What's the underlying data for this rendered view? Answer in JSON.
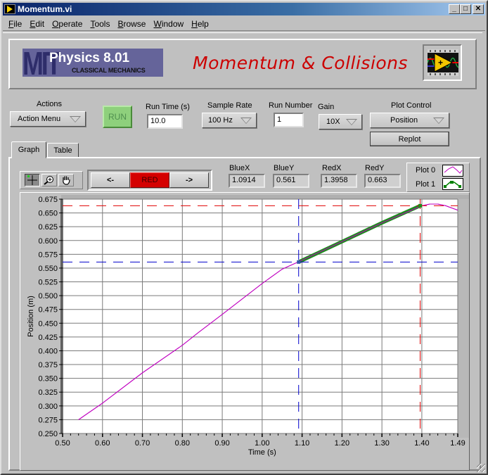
{
  "window": {
    "title": "Momentum.vi",
    "controls": {
      "minimize": "_",
      "maximize": "□",
      "close": "✕"
    }
  },
  "menu": [
    {
      "label": "File",
      "hotkey": "F"
    },
    {
      "label": "Edit",
      "hotkey": "E"
    },
    {
      "label": "Operate",
      "hotkey": "O"
    },
    {
      "label": "Tools",
      "hotkey": "T"
    },
    {
      "label": "Browse",
      "hotkey": "B"
    },
    {
      "label": "Window",
      "hotkey": "W"
    },
    {
      "label": "Help",
      "hotkey": "H"
    }
  ],
  "header": {
    "logo_mit": "MIT",
    "logo_course": "Physics 8.01",
    "logo_subtitle": "CLASSICAL MECHANICS",
    "title": "Momentum & Collisions",
    "vi_icon": "labview-vi-icon"
  },
  "controls": {
    "actions_label": "Actions",
    "actions_value": "Action Menu",
    "run_label": "RUN",
    "run_time_label": "Run Time (s)",
    "run_time_value": "10.0",
    "sample_rate_label": "Sample Rate",
    "sample_rate_value": "100 Hz",
    "run_number_label": "Run Number",
    "run_number_value": "1",
    "gain_label": "Gain",
    "gain_value": "10X",
    "plot_control_label": "Plot Control",
    "plot_control_value": "Position",
    "replot_label": "Replot"
  },
  "tabs": [
    {
      "label": "Graph",
      "active": true
    },
    {
      "label": "Table",
      "active": false
    }
  ],
  "graph_toolbar": {
    "tools": [
      "cursor-crosshair-icon",
      "zoom-icon",
      "pan-hand-icon"
    ],
    "prev_label": "<-",
    "cursor_select_label": "RED",
    "next_label": "->",
    "readouts": [
      {
        "label": "BlueX",
        "value": "1.0914"
      },
      {
        "label": "BlueY",
        "value": "0.561"
      },
      {
        "label": "RedX",
        "value": "1.3958"
      },
      {
        "label": "RedY",
        "value": "0.663"
      }
    ],
    "legend": [
      {
        "label": "Plot 0",
        "color": "#c000c0"
      },
      {
        "label": "Plot 1",
        "color": "#008000"
      }
    ]
  },
  "colors": {
    "plot0": "#c000c0",
    "plot1": "#1e8c1e",
    "blue_cursor": "#0000cc",
    "red_cursor": "#e00000",
    "grid": "#7a7a7a",
    "title_red": "#cc0000",
    "run_green": "#8ed07c"
  },
  "chart_data": {
    "type": "line",
    "title": "",
    "xlabel": "Time (s)",
    "ylabel": "Position (m)",
    "xlim": [
      0.5,
      1.49
    ],
    "ylim": [
      0.25,
      0.675
    ],
    "xticks": [
      "0.50",
      "0.60",
      "0.70",
      "0.80",
      "0.90",
      "1.00",
      "1.10",
      "1.20",
      "1.30",
      "1.40",
      "1.49"
    ],
    "xtick_values": [
      0.5,
      0.6,
      0.7,
      0.8,
      0.9,
      1.0,
      1.1,
      1.2,
      1.3,
      1.4,
      1.49
    ],
    "yticks": [
      "0.675",
      "0.650",
      "0.625",
      "0.600",
      "0.575",
      "0.550",
      "0.525",
      "0.500",
      "0.475",
      "0.450",
      "0.425",
      "0.400",
      "0.375",
      "0.350",
      "0.325",
      "0.300",
      "0.275",
      "0.250"
    ],
    "ytick_values": [
      0.675,
      0.65,
      0.625,
      0.6,
      0.575,
      0.55,
      0.525,
      0.5,
      0.475,
      0.45,
      0.425,
      0.4,
      0.375,
      0.35,
      0.325,
      0.3,
      0.275,
      0.25
    ],
    "grid": true,
    "legend_position": "top-right",
    "series": [
      {
        "name": "Plot 0",
        "color": "#c000c0",
        "x": [
          0.54,
          0.6,
          0.7,
          0.8,
          0.84,
          0.9,
          1.0,
          1.05,
          1.09,
          1.2,
          1.3,
          1.4,
          1.42,
          1.44,
          1.46,
          1.49
        ],
        "y": [
          0.275,
          0.305,
          0.36,
          0.41,
          0.433,
          0.466,
          0.522,
          0.548,
          0.561,
          0.598,
          0.632,
          0.663,
          0.666,
          0.666,
          0.663,
          0.655
        ]
      },
      {
        "name": "Plot 1",
        "color": "#1e8c1e",
        "x": [
          1.0914,
          1.2,
          1.3,
          1.3958
        ],
        "y": [
          0.561,
          0.598,
          0.632,
          0.663
        ]
      }
    ],
    "cursors": [
      {
        "name": "Blue",
        "x": 1.0914,
        "y": 0.561,
        "color": "#0000cc"
      },
      {
        "name": "Red",
        "x": 1.3958,
        "y": 0.663,
        "color": "#e00000"
      }
    ]
  }
}
